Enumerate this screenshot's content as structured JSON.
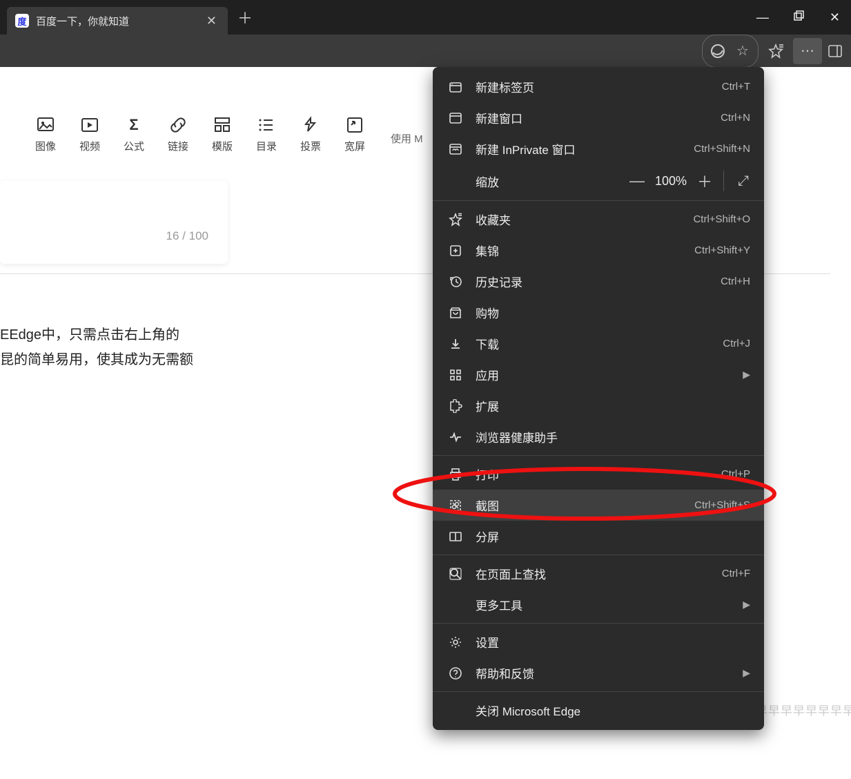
{
  "tab": {
    "title": "百度一下，你就知道"
  },
  "editor": {
    "buttons": [
      {
        "icon": "image",
        "label": "图像"
      },
      {
        "icon": "video",
        "label": "视频"
      },
      {
        "icon": "formula",
        "label": "公式"
      },
      {
        "icon": "link",
        "label": "链接"
      },
      {
        "icon": "template",
        "label": "模版"
      },
      {
        "icon": "toc",
        "label": "目录"
      },
      {
        "icon": "vote",
        "label": "投票"
      },
      {
        "icon": "fullscreen",
        "label": "宽屏"
      }
    ],
    "hint": "使用 M",
    "counter": "16 / 100",
    "body_line1": "EEdge中，只需点击右上角的",
    "body_line2": "昆的简单易用，使其成为无需额"
  },
  "zoom": {
    "label": "缩放",
    "value": "100%"
  },
  "menu": {
    "groups": [
      [
        {
          "icon": "tab",
          "label": "新建标签页",
          "shortcut": "Ctrl+T"
        },
        {
          "icon": "window",
          "label": "新建窗口",
          "shortcut": "Ctrl+N"
        },
        {
          "icon": "inprivate",
          "label": "新建 InPrivate 窗口",
          "shortcut": "Ctrl+Shift+N"
        }
      ],
      [
        {
          "icon": "favorites",
          "label": "收藏夹",
          "shortcut": "Ctrl+Shift+O"
        },
        {
          "icon": "collections",
          "label": "集锦",
          "shortcut": "Ctrl+Shift+Y"
        },
        {
          "icon": "history",
          "label": "历史记录",
          "shortcut": "Ctrl+H"
        },
        {
          "icon": "shopping",
          "label": "购物",
          "shortcut": ""
        },
        {
          "icon": "download",
          "label": "下载",
          "shortcut": "Ctrl+J"
        },
        {
          "icon": "apps",
          "label": "应用",
          "shortcut": "",
          "arrow": true
        },
        {
          "icon": "extensions",
          "label": "扩展",
          "shortcut": ""
        },
        {
          "icon": "health",
          "label": "浏览器健康助手",
          "shortcut": ""
        }
      ],
      [
        {
          "icon": "print",
          "label": "打印",
          "shortcut": "Ctrl+P"
        },
        {
          "icon": "screenshot",
          "label": "截图",
          "shortcut": "Ctrl+Shift+S",
          "hover": true
        },
        {
          "icon": "split",
          "label": "分屏",
          "shortcut": ""
        }
      ],
      [
        {
          "icon": "find",
          "label": "在页面上查找",
          "shortcut": "Ctrl+F"
        },
        {
          "icon": "",
          "label": "更多工具",
          "shortcut": "",
          "arrow": true
        }
      ],
      [
        {
          "icon": "settings",
          "label": "设置",
          "shortcut": ""
        },
        {
          "icon": "help",
          "label": "帮助和反馈",
          "shortcut": "",
          "arrow": true
        }
      ],
      [
        {
          "icon": "",
          "label": "关闭 Microsoft Edge",
          "shortcut": ""
        }
      ]
    ]
  },
  "watermark": "CSDN @无利不起早早早早早早早早早"
}
